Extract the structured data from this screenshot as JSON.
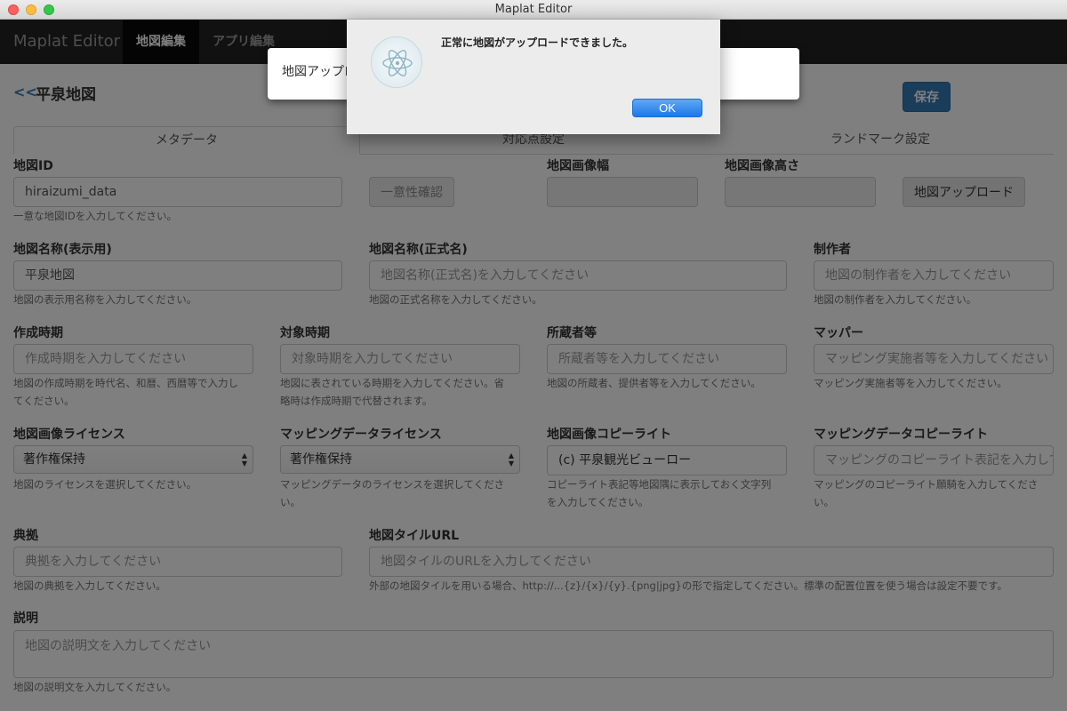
{
  "window": {
    "title": "Maplat Editor"
  },
  "navbar": {
    "brand": "Maplat Editor",
    "tabs": [
      "地図編集",
      "アプリ編集"
    ]
  },
  "page": {
    "back_label": "<<",
    "title": "平泉地図",
    "save_label": "保存"
  },
  "tabs": [
    "メタデータ",
    "対応点設定",
    "ランドマーク設定"
  ],
  "form": {
    "map_id": {
      "label": "地図ID",
      "value": "hiraizumi_data",
      "help": "一意な地図IDを入力してください。"
    },
    "unique_check_label": "一意性確認",
    "image_width": {
      "label": "地図画像幅"
    },
    "image_height": {
      "label": "地図画像高さ"
    },
    "upload_label": "地図アップロード",
    "display_name": {
      "label": "地図名称(表示用)",
      "value": "平泉地図",
      "help": "地図の表示用名称を入力してください。"
    },
    "official_name": {
      "label": "地図名称(正式名)",
      "placeholder": "地図名称(正式名)を入力してください",
      "help": "地図の正式名称を入力してください。"
    },
    "creator": {
      "label": "制作者",
      "placeholder": "地図の制作者を入力してください",
      "help": "地図の制作者を入力してください。"
    },
    "created_period": {
      "label": "作成時期",
      "placeholder": "作成時期を入力してください",
      "help1": "地図の作成時期を時代名、和暦、西暦等で入力し",
      "help2": "てください。"
    },
    "target_period": {
      "label": "対象時期",
      "placeholder": "対象時期を入力してください",
      "help1": "地図に表されている時期を入力してください。省",
      "help2": "略時は作成時期で代替されます。"
    },
    "owner": {
      "label": "所蔵者等",
      "placeholder": "所蔵者等を入力してください",
      "help": "地図の所蔵者、提供者等を入力してください。"
    },
    "mapper": {
      "label": "マッパー",
      "placeholder": "マッピング実施者等を入力してください",
      "help": "マッピング実施者等を入力してください。"
    },
    "image_license": {
      "label": "地図画像ライセンス",
      "value": "著作権保持",
      "help": "地図のライセンスを選択してください。"
    },
    "data_license": {
      "label": "マッピングデータライセンス",
      "value": "著作権保持",
      "help1": "マッピングデータのライセンスを選択してくださ",
      "help2": "い。"
    },
    "image_copyright": {
      "label": "地図画像コピーライト",
      "value": "(c) 平泉観光ビューロー",
      "help1": "コピーライト表記等地図隅に表示しておく文字列",
      "help2": "を入力してください。"
    },
    "data_copyright": {
      "label": "マッピングデータコピーライト",
      "placeholder": "マッピングのコピーライト表記を入力してください",
      "help1": "マッピングのコピーライト願騎を入力してくださ",
      "help2": "い。"
    },
    "source": {
      "label": "典拠",
      "placeholder": "典拠を入力してください",
      "help": "地図の典拠を入力してください。"
    },
    "tile_url": {
      "label": "地図タイルURL",
      "placeholder": "地図タイルのURLを入力してください",
      "help": "外部の地図タイルを用いる場合、http://...{z}/{x}/{y}.{png|jpg}の形で指定してください。標準の配置位置を使う場合は設定不要です。"
    },
    "description": {
      "label": "説明",
      "placeholder": "地図の説明文を入力してください",
      "help": "地図の説明文を入力してください。"
    }
  },
  "modal_behind": {
    "text": "地図アップロ"
  },
  "dialog": {
    "message": "正常に地図がアップロードできました。",
    "ok_label": "OK"
  }
}
